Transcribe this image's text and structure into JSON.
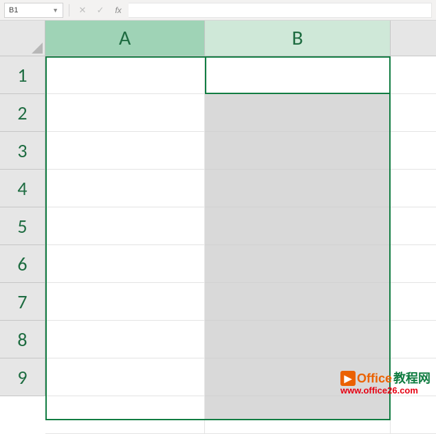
{
  "formula_bar": {
    "name_box": "B1",
    "cancel_symbol": "✕",
    "enter_symbol": "✓",
    "fx_label": "fx",
    "formula_value": ""
  },
  "columns": [
    "A",
    "B"
  ],
  "rows": [
    "1",
    "2",
    "3",
    "4",
    "5",
    "6",
    "7",
    "8",
    "9"
  ],
  "active_cell": "B1",
  "selected_range": "A:B",
  "watermark": {
    "brand_prefix": "Office",
    "brand_suffix": "教程网",
    "url": "www.office26.com"
  }
}
